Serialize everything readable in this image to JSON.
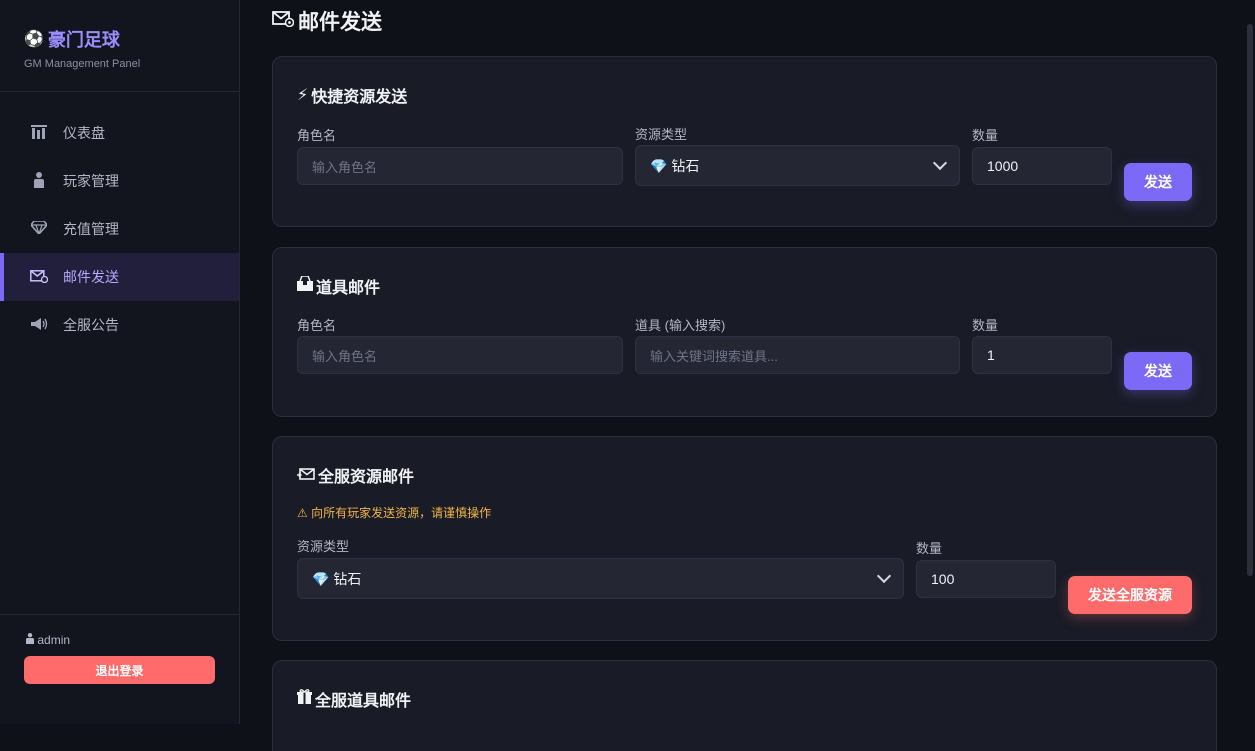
{
  "brand": {
    "icon": "soccer-ball-icon",
    "title": "豪门足球",
    "subtitle": "GM Management Panel"
  },
  "nav": [
    {
      "icon": "chart-bars-icon",
      "label": "仪表盘",
      "active": false
    },
    {
      "icon": "person-icon",
      "label": "玩家管理",
      "active": false
    },
    {
      "icon": "diamond-icon",
      "label": "充值管理",
      "active": false
    },
    {
      "icon": "mail-icon",
      "label": "邮件发送",
      "active": true
    },
    {
      "icon": "megaphone-icon",
      "label": "全服公告",
      "active": false
    }
  ],
  "footer": {
    "user": "admin",
    "logout": "退出登录"
  },
  "page": {
    "title": "邮件发送"
  },
  "quick": {
    "title": "快捷资源发送",
    "role_label": "角色名",
    "role_placeholder": "输入角色名",
    "type_label": "资源类型",
    "type_value": "💎 钻石",
    "qty_label": "数量",
    "qty_value": "1000",
    "send": "发送"
  },
  "item": {
    "title": "道具邮件",
    "role_label": "角色名",
    "role_placeholder": "输入角色名",
    "item_label": "道具 (输入搜索)",
    "item_placeholder": "输入关键词搜索道具...",
    "qty_label": "数量",
    "qty_value": "1",
    "send": "发送"
  },
  "server_res": {
    "title": "全服资源邮件",
    "warning": "⚠ 向所有玩家发送资源，请谨慎操作",
    "type_label": "资源类型",
    "type_value": "💎 钻石",
    "qty_label": "数量",
    "qty_value": "100",
    "send": "发送全服资源"
  },
  "server_item": {
    "title": "全服道具邮件"
  },
  "colors": {
    "accent": "#7c69f5",
    "danger": "#ff6b6b",
    "warning": "#f2b544",
    "background": "#0f1118"
  }
}
